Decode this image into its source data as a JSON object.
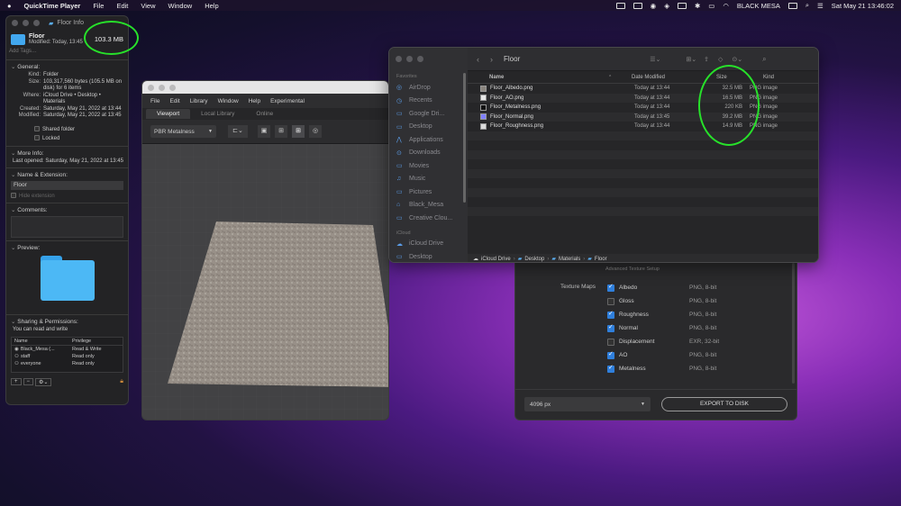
{
  "menubar": {
    "app": "QuickTime Player",
    "items": [
      "File",
      "Edit",
      "View",
      "Window",
      "Help"
    ],
    "user": "BLACK MESA",
    "clock": "Sat May 21  13:46:02"
  },
  "info": {
    "title": "Floor Info",
    "name": "Floor",
    "modified": "Modified: Today, 13:45",
    "size": "103.3 MB",
    "add_tags": "Add Tags…",
    "general_label": "General:",
    "general": [
      {
        "k": "Kind:",
        "v": "Folder"
      },
      {
        "k": "Size:",
        "v": "103,317,560 bytes (105.5 MB on disk) for 6 items"
      },
      {
        "k": "Where:",
        "v": "iCloud Drive • Desktop • Materials"
      },
      {
        "k": "Created:",
        "v": "Saturday, May 21, 2022 at 13:44"
      },
      {
        "k": "Modified:",
        "v": "Saturday, May 21, 2022 at 13:45"
      }
    ],
    "shared": "Shared folder",
    "locked": "Locked",
    "more_label": "More Info:",
    "last_opened": "Last opened: Saturday, May 21, 2022 at 13:45",
    "name_ext_label": "Name & Extension:",
    "name_value": "Floor",
    "hide_ext": "Hide extension",
    "comments_label": "Comments:",
    "preview_label": "Preview:",
    "sharing_label": "Sharing & Permissions:",
    "sharing_note": "You can read and write",
    "perm_head": {
      "name": "Name",
      "priv": "Privilege"
    },
    "perms": [
      {
        "name": "Black_Mesa (...",
        "priv": "Read & Write"
      },
      {
        "name": "staff",
        "priv": "Read only"
      },
      {
        "name": "everyone",
        "priv": "Read only"
      }
    ]
  },
  "viewport": {
    "menu": [
      "File",
      "Edit",
      "Library",
      "Window",
      "Help",
      "Experimental"
    ],
    "tabs": [
      "Viewport",
      "Local Library",
      "Online"
    ],
    "shader": "PBR Metalness"
  },
  "finder": {
    "title": "Floor",
    "favorites_label": "Favorites",
    "favorites": [
      {
        "label": "AirDrop",
        "icon": "◎"
      },
      {
        "label": "Recents",
        "icon": "◷"
      },
      {
        "label": "Google Dri...",
        "icon": "▭"
      },
      {
        "label": "Desktop",
        "icon": "▭"
      },
      {
        "label": "Applications",
        "icon": "⋀"
      },
      {
        "label": "Downloads",
        "icon": "⊙"
      },
      {
        "label": "Movies",
        "icon": "▭"
      },
      {
        "label": "Music",
        "icon": "♫"
      },
      {
        "label": "Pictures",
        "icon": "▭"
      },
      {
        "label": "Black_Mesa",
        "icon": "⌂"
      },
      {
        "label": "Creative Clou...",
        "icon": "▭"
      }
    ],
    "icloud_label": "iCloud",
    "icloud": [
      {
        "label": "iCloud Drive",
        "icon": "☁"
      },
      {
        "label": "Desktop",
        "icon": "▭"
      }
    ],
    "cols": {
      "name": "Name",
      "date": "Date Modified",
      "size": "Size",
      "kind": "Kind"
    },
    "files": [
      {
        "name": "Floor_Albedo.png",
        "date": "Today at 13:44",
        "size": "32.5 MB",
        "kind": "PNG image",
        "sw": "#8a857e"
      },
      {
        "name": "Floor_AO.png",
        "date": "Today at 13:44",
        "size": "16.5 MB",
        "kind": "PNG image",
        "sw": "#e8e8e8"
      },
      {
        "name": "Floor_Metalness.png",
        "date": "Today at 13:44",
        "size": "220 KB",
        "kind": "PNG image",
        "sw": "#111111"
      },
      {
        "name": "Floor_Normal.png",
        "date": "Today at 13:45",
        "size": "39.2 MB",
        "kind": "PNG image",
        "sw": "#8080ff"
      },
      {
        "name": "Floor_Roughness.png",
        "date": "Today at 13:44",
        "size": "14.9 MB",
        "kind": "PNG image",
        "sw": "#dcdcdc"
      }
    ],
    "path": [
      "iCloud Drive",
      "Desktop",
      "Materials",
      "Floor"
    ]
  },
  "export": {
    "setup": "Advanced Texture Setup",
    "maps_label": "Texture Maps",
    "maps": [
      {
        "name": "Albedo",
        "fmt": "PNG, 8-bit",
        "on": true
      },
      {
        "name": "Gloss",
        "fmt": "PNG, 8-bit",
        "on": false
      },
      {
        "name": "Roughness",
        "fmt": "PNG, 8-bit",
        "on": true
      },
      {
        "name": "Normal",
        "fmt": "PNG, 8-bit",
        "on": true
      },
      {
        "name": "Displacement",
        "fmt": "EXR, 32-bit",
        "on": false
      },
      {
        "name": "AO",
        "fmt": "PNG, 8-bit",
        "on": true
      },
      {
        "name": "Metalness",
        "fmt": "PNG, 8-bit",
        "on": true
      }
    ],
    "resolution": "4096 px",
    "button": "EXPORT TO DISK"
  }
}
